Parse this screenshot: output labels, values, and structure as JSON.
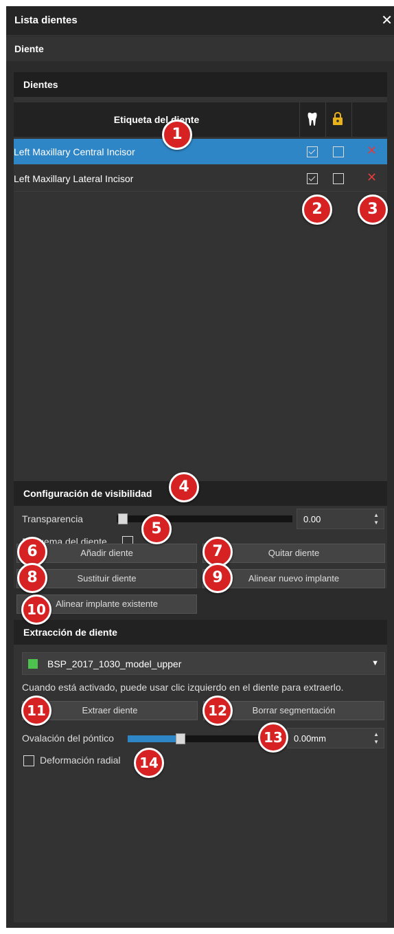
{
  "window": {
    "title": "Lista dientes",
    "close_glyph": "✕"
  },
  "section": {
    "title": "Diente"
  },
  "teeth_group": {
    "title": "Dientes",
    "columns": {
      "label": "Etiqueta del diente",
      "visible_icon": "tooth-icon",
      "lock_icon": "lock-icon"
    },
    "rows": [
      {
        "name": "Left Maxillary Central Incisor",
        "visible": true,
        "locked": false,
        "selected": true
      },
      {
        "name": "Left Maxillary Lateral Incisor",
        "visible": true,
        "locked": false,
        "selected": false
      }
    ],
    "delete_glyph": "✕"
  },
  "visibility": {
    "title": "Configuración de visibilidad",
    "transparency_label": "Transparencia",
    "transparency_value": "0.00",
    "transparency_level": 0.0,
    "outline_label": "Esquema del diente",
    "outline_checked": false
  },
  "actions": {
    "add": "Añadir diente",
    "remove": "Quitar diente",
    "replace": "Sustituir diente",
    "align_new": "Alinear nuevo implante",
    "align_existing": "Alinear implante existente"
  },
  "extraction": {
    "title": "Extracción de diente",
    "model": "BSP_2017_1030_model_upper",
    "model_color": "#4ec24e",
    "hint": "Cuando está activado, puede usar clic izquierdo en el diente para extraerlo.",
    "extract_btn": "Extraer diente",
    "clear_btn": "Borrar segmentación",
    "pontic_label": "Ovalación del póntico",
    "pontic_value": "0.00mm",
    "pontic_level": 0.34,
    "radial_label": "Deformación radial",
    "radial_checked": false
  },
  "callouts": [
    "1",
    "2",
    "3",
    "4",
    "5",
    "6",
    "7",
    "8",
    "9",
    "10",
    "11",
    "12",
    "13",
    "14"
  ],
  "colors": {
    "accent": "#2f86c7",
    "badge": "#d62222",
    "delete": "#e23b3b"
  }
}
